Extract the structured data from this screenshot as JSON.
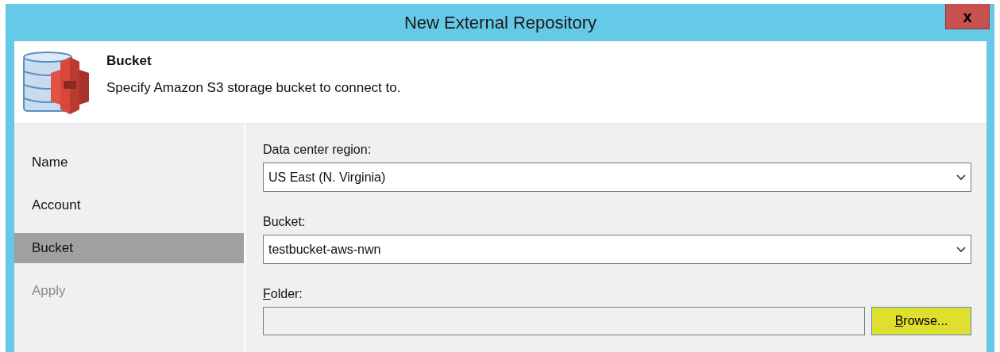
{
  "window": {
    "title": "New External Repository",
    "close_label": "x"
  },
  "header": {
    "title": "Bucket",
    "description": "Specify Amazon S3 storage bucket to connect to."
  },
  "sidebar": {
    "items": [
      {
        "label": "Name",
        "selected": false,
        "disabled": false
      },
      {
        "label": "Account",
        "selected": false,
        "disabled": false
      },
      {
        "label": "Bucket",
        "selected": true,
        "disabled": false
      },
      {
        "label": "Apply",
        "selected": false,
        "disabled": true
      }
    ]
  },
  "fields": [
    {
      "kind": "dropdown",
      "label": "Data center region:",
      "value": "US East (N. Virginia)",
      "mnemonic": false
    },
    {
      "kind": "dropdown",
      "label": "Bucket:",
      "value": "testbucket-aws-nwn",
      "mnemonic": false
    },
    {
      "kind": "browse",
      "label": "Folder:",
      "mnemonic": true,
      "button": {
        "label": "Browse...",
        "mnemonic": true
      }
    }
  ]
}
